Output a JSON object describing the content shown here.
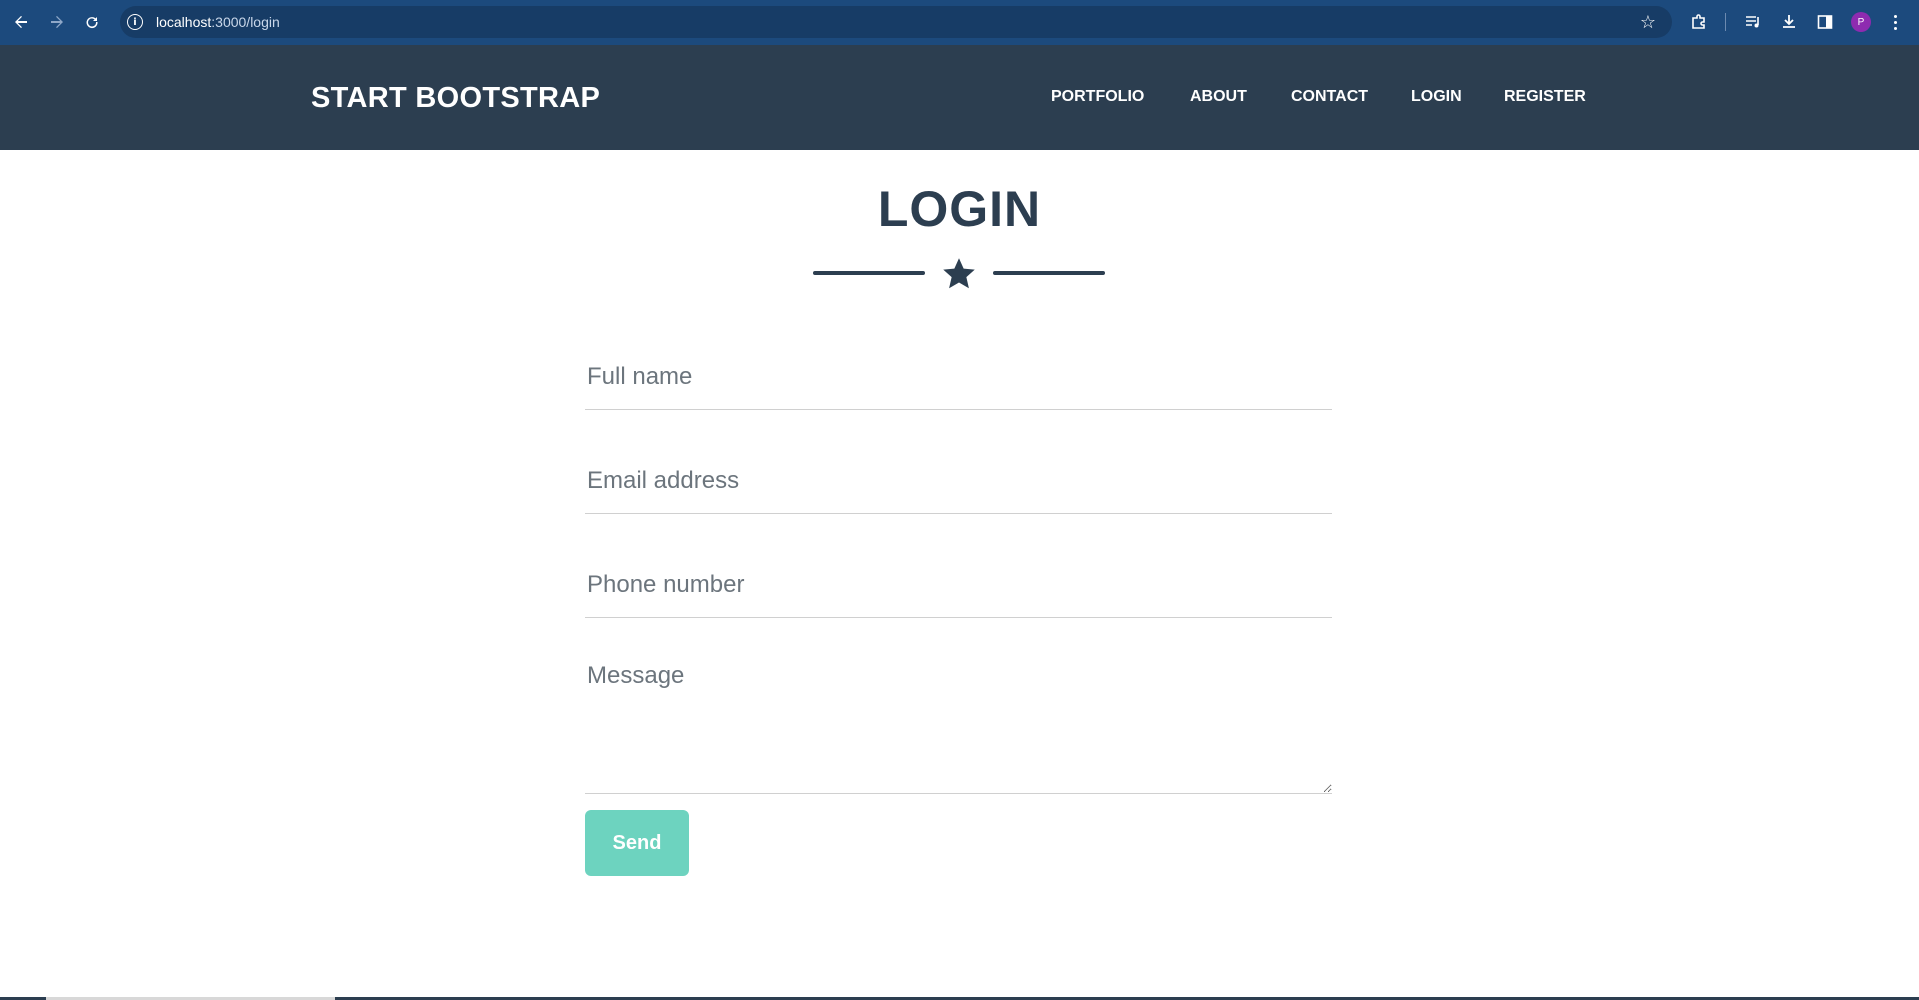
{
  "browser": {
    "url_host": "localhost",
    "url_path": ":3000/login",
    "profile_initial": "P",
    "icons": [
      "back-arrow-icon",
      "forward-arrow-icon",
      "reload-icon",
      "site-info-icon",
      "bookmark-star-icon",
      "extensions-icon",
      "media-control-icon",
      "download-icon",
      "side-panel-icon",
      "profile-avatar",
      "menu-dots-icon"
    ]
  },
  "navbar": {
    "brand": "START BOOTSTRAP",
    "links": [
      "PORTFOLIO",
      "ABOUT",
      "CONTACT",
      "LOGIN",
      "REGISTER"
    ]
  },
  "main": {
    "title": "LOGIN",
    "divider_icon": "star-icon",
    "form": {
      "full_name_placeholder": "Full name",
      "email_placeholder": "Email address",
      "phone_placeholder": "Phone number",
      "message_placeholder": "Message",
      "send_label": "Send"
    }
  },
  "colors": {
    "browser_bar": "#1c4a7d",
    "navbar": "#2c3e50",
    "title": "#2c3e50",
    "send_button": "#6dd3bf"
  }
}
